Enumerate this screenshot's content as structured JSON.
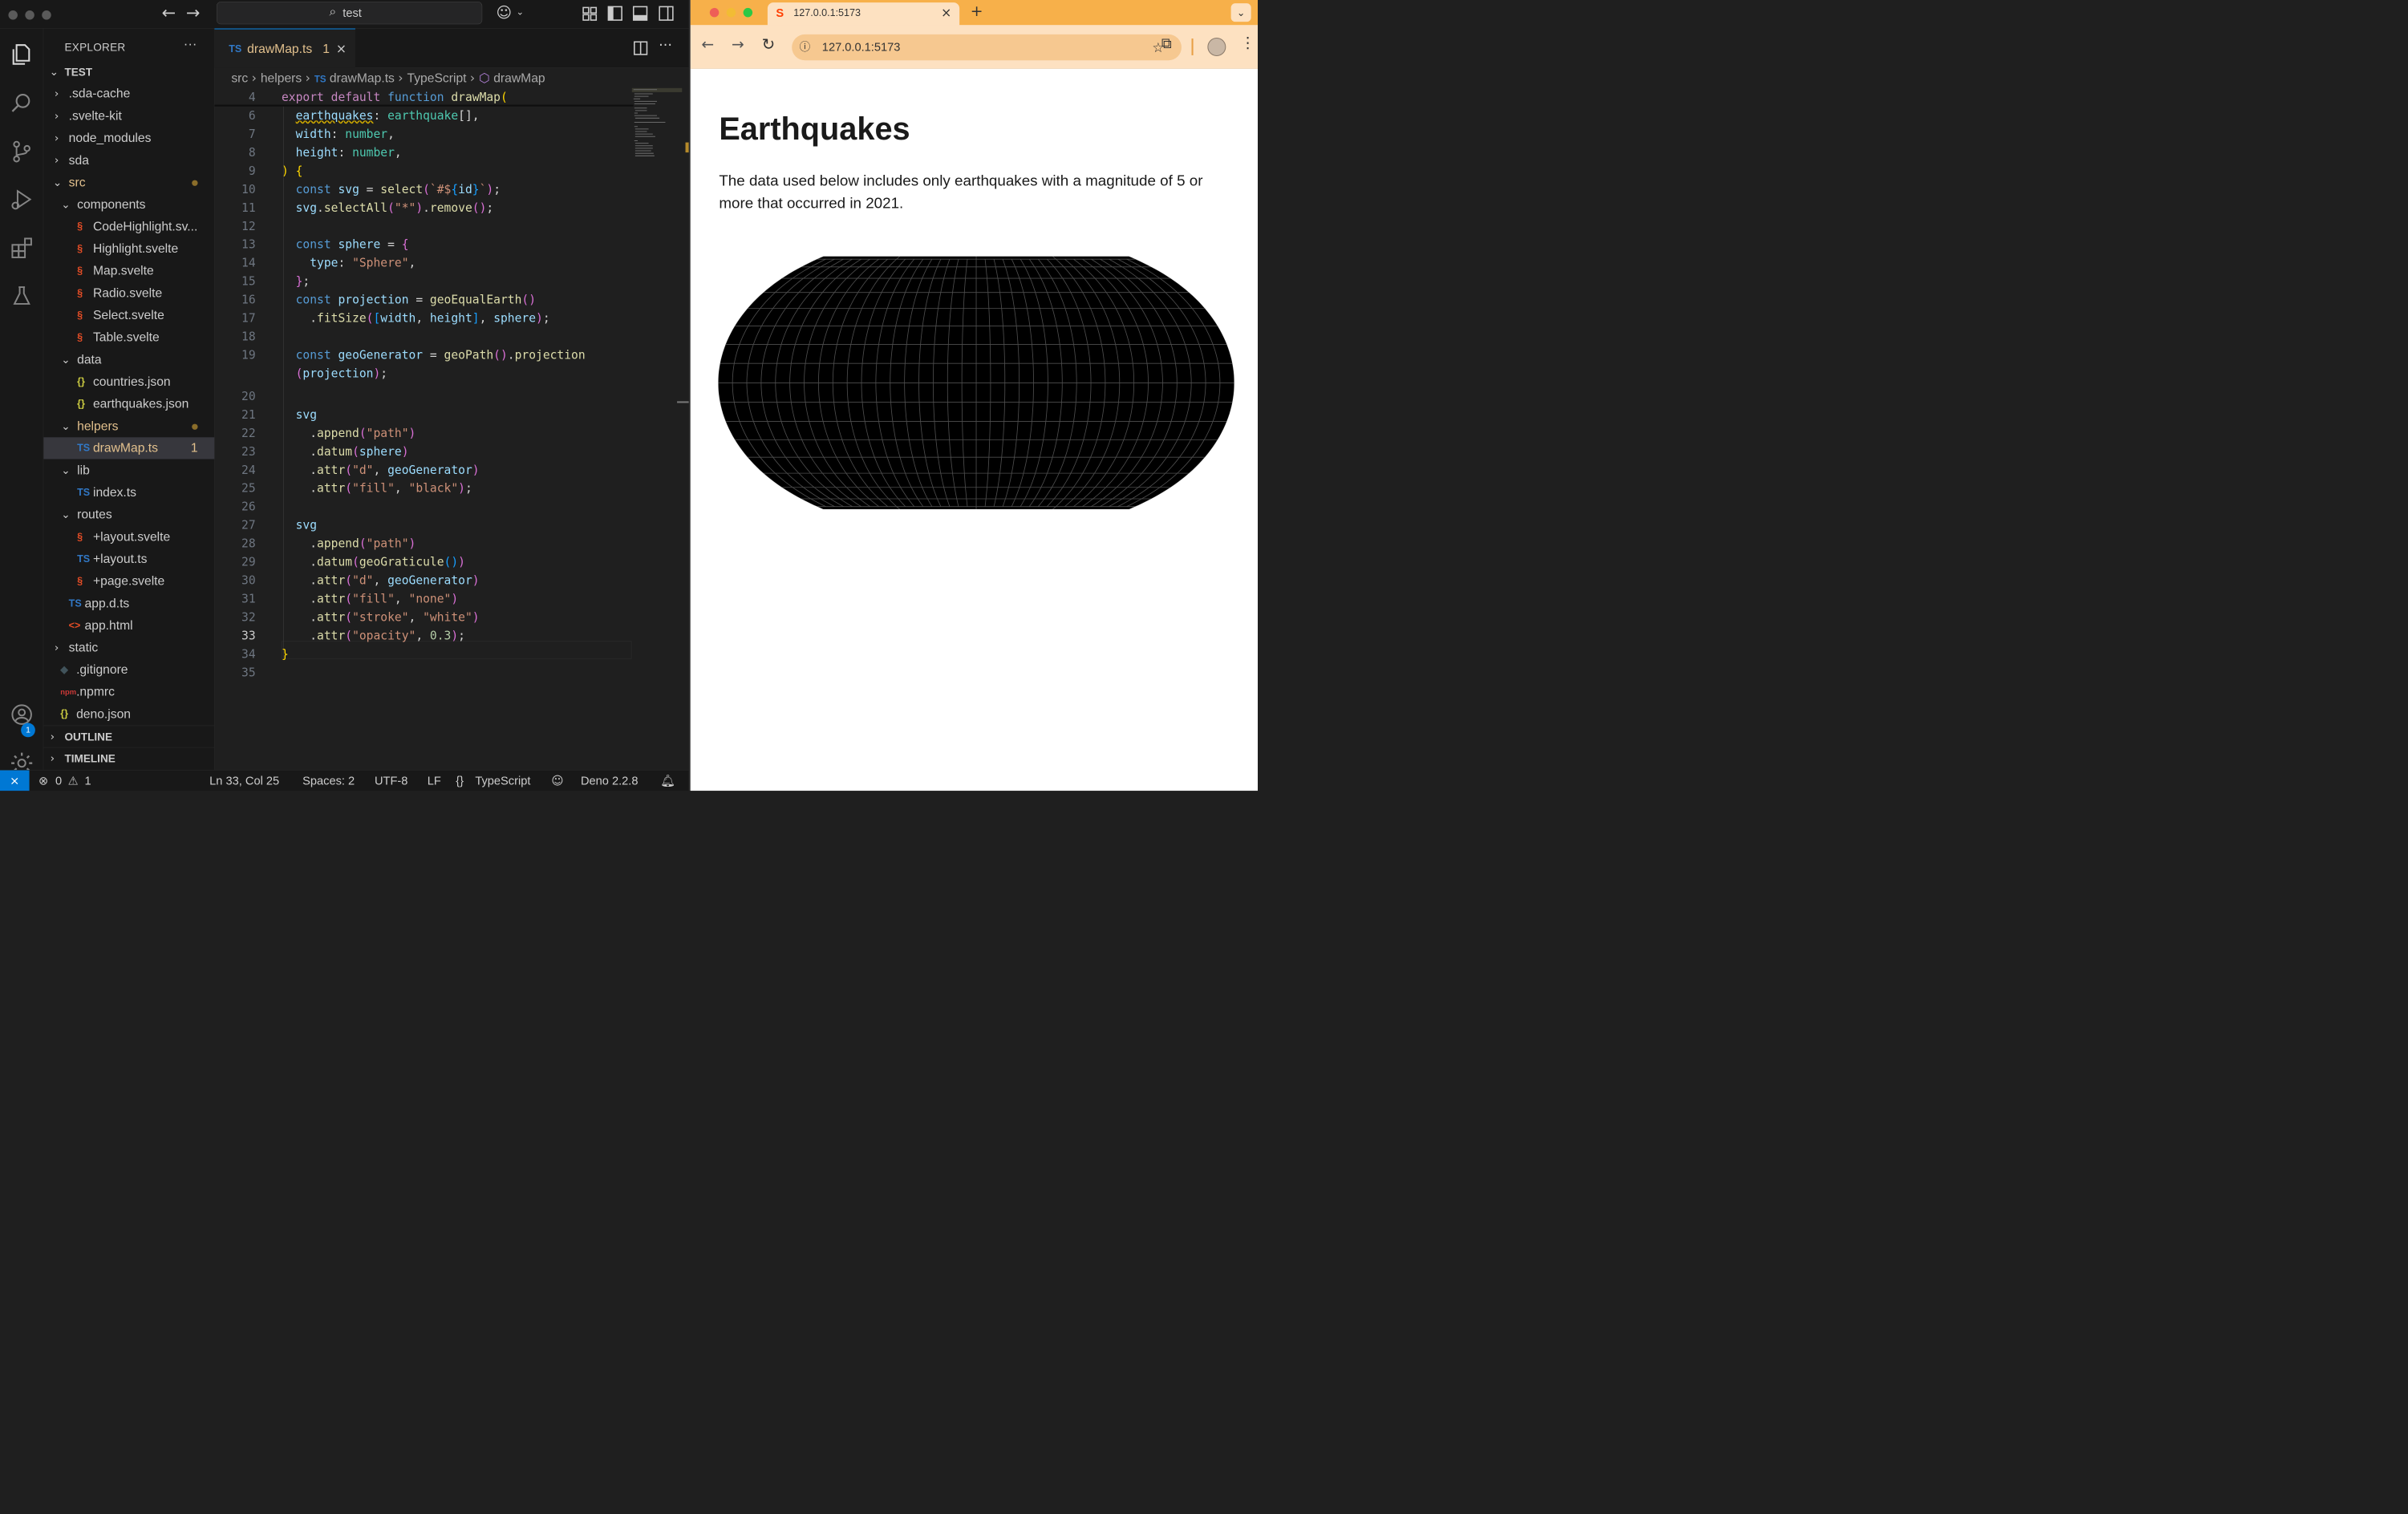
{
  "vscode": {
    "command_center": {
      "label": "test"
    },
    "explorer": {
      "title": "EXPLORER",
      "root": "TEST",
      "items": [
        {
          "label": ".sda-cache"
        },
        {
          "label": ".svelte-kit"
        },
        {
          "label": "node_modules"
        },
        {
          "label": "sda"
        },
        {
          "label": "src"
        },
        {
          "label": "components"
        },
        {
          "label": "CodeHighlight.sv..."
        },
        {
          "label": "Highlight.svelte"
        },
        {
          "label": "Map.svelte"
        },
        {
          "label": "Radio.svelte"
        },
        {
          "label": "Select.svelte"
        },
        {
          "label": "Table.svelte"
        },
        {
          "label": "data"
        },
        {
          "label": "countries.json"
        },
        {
          "label": "earthquakes.json"
        },
        {
          "label": "helpers"
        },
        {
          "label": "drawMap.ts",
          "badge": "1"
        },
        {
          "label": "lib"
        },
        {
          "label": "index.ts"
        },
        {
          "label": "routes"
        },
        {
          "label": "+layout.svelte"
        },
        {
          "label": "+layout.ts"
        },
        {
          "label": "+page.svelte"
        },
        {
          "label": "app.d.ts"
        },
        {
          "label": "app.html"
        },
        {
          "label": "static"
        },
        {
          "label": ".gitignore"
        },
        {
          "label": ".npmrc"
        },
        {
          "label": "deno.json"
        }
      ],
      "outline": "OUTLINE",
      "timeline": "TIMELINE",
      "accounts_badge": "1"
    },
    "editor": {
      "tab_label": "drawMap.ts",
      "tab_problems": "1",
      "tab_lang_icon": "TS",
      "breadcrumb": {
        "src": "src",
        "helpers": "helpers",
        "file": "drawMap.ts",
        "lang": "TypeScript",
        "symbol": "drawMap"
      },
      "lines": {
        "l4": "4",
        "l6": "6",
        "l7": "7",
        "l8": "8",
        "l9": "9",
        "l10": "10",
        "l11": "11",
        "l12": "12",
        "l13": "13",
        "l14": "14",
        "l15": "15",
        "l16": "16",
        "l17": "17",
        "l18": "18",
        "l19": "19",
        "l20": "20",
        "l21": "21",
        "l22": "22",
        "l23": "23",
        "l24": "24",
        "l25": "25",
        "l26": "26",
        "l27": "27",
        "l28": "28",
        "l29": "29",
        "l30": "30",
        "l31": "31",
        "l32": "32",
        "l33": "33",
        "l34": "34",
        "l35": "35"
      }
    },
    "status": {
      "errors": "0",
      "warnings": "1",
      "position": "Ln 33, Col 25",
      "spaces": "Spaces: 2",
      "encoding": "UTF-8",
      "eol": "LF",
      "language": "TypeScript",
      "runtime": "Deno 2.2.8"
    }
  },
  "browser": {
    "tab_title": "127.0.0.1:5173",
    "url": "127.0.0.1:5173",
    "page": {
      "heading": "Earthquakes",
      "paragraph": "The data used below includes only earthquakes with a magnitude of 5 or more that occurred in 2021."
    },
    "map": {
      "projection": "geoEqualEarth",
      "fill": "#000000",
      "graticule_stroke": "#ffffff",
      "graticule_opacity": 0.3
    }
  }
}
